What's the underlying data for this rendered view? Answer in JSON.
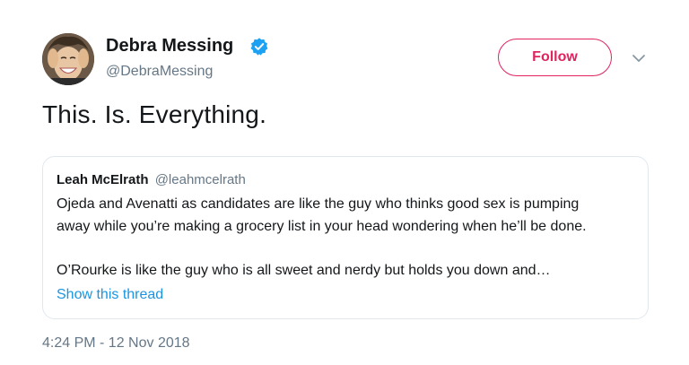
{
  "author": {
    "display_name": "Debra Messing",
    "handle": "@DebraMessing",
    "verified_icon": "verified-badge-icon",
    "avatar_icon": "avatar"
  },
  "actions": {
    "follow_label": "Follow",
    "menu_icon": "chevron-down-icon"
  },
  "tweet": {
    "text": "This. Is. Everything.",
    "timestamp": "4:24 PM - 12 Nov 2018"
  },
  "quoted_tweet": {
    "author_name": "Leah McElrath",
    "author_handle": "@leahmcelrath",
    "lines": [
      "Ojeda and Avenatti as candidates are like the guy who thinks good sex is pumping",
      "away while you’re making a grocery list in your head wondering when he’ll be done.",
      "O’Rourke is like the guy who is all sweet and nerdy but holds you down and…"
    ],
    "show_thread_label": "Show this thread"
  },
  "colors": {
    "follow_accent": "#e0245e",
    "link_blue": "#1b95e0",
    "verified_blue": "#1da1f2",
    "secondary_text": "#657786",
    "primary_text": "#14171a",
    "border": "#e1e8ed"
  }
}
